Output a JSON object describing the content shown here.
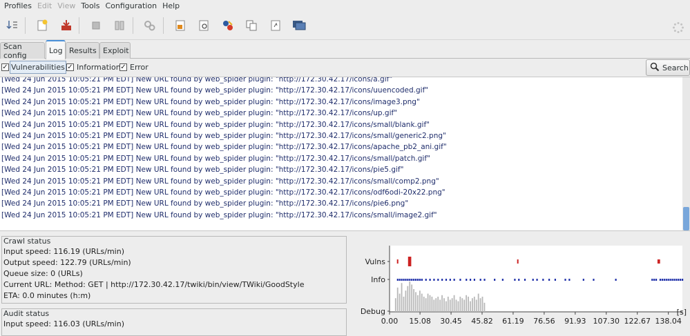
{
  "menu": {
    "items": [
      {
        "label": "Profiles",
        "enabled": true
      },
      {
        "label": "Edit",
        "enabled": false
      },
      {
        "label": "View",
        "enabled": false
      },
      {
        "label": "Tools",
        "enabled": true
      },
      {
        "label": "Configuration",
        "enabled": true
      },
      {
        "label": "Help",
        "enabled": true
      }
    ]
  },
  "toolbar": {
    "buttons": [
      "import-down-icon",
      "new-profile-icon",
      "save-profile-icon",
      "stop-icon",
      "pause-icon",
      "settings-gears-icon",
      "proxy-icon",
      "manual-request-icon",
      "fuzzy-request-icon",
      "compare-icon",
      "encode-decode-icon",
      "cluster-icon"
    ],
    "spinner_icon": "throbber-icon"
  },
  "tabs": [
    {
      "label": "Scan config",
      "active": false
    },
    {
      "label": "Log",
      "active": true
    },
    {
      "label": "Results",
      "active": false
    },
    {
      "label": "Exploit",
      "active": false
    }
  ],
  "filters": {
    "vulnerabilities": {
      "label": "Vulnerabilities",
      "checked": true
    },
    "information": {
      "label": "Information",
      "checked": true
    },
    "error": {
      "label": "Error",
      "checked": true
    },
    "search_label": "Search",
    "search_icon": "magnifier-icon"
  },
  "log": {
    "lines": [
      "[Wed 24 Jun 2015 10:05:21 PM EDT] New URL found by web_spider plugin: \"http://172.30.42.17/icons/a.gif\"",
      "[Wed 24 Jun 2015 10:05:21 PM EDT] New URL found by web_spider plugin: \"http://172.30.42.17/icons/uuencoded.gif\"",
      "[Wed 24 Jun 2015 10:05:21 PM EDT] New URL found by web_spider plugin: \"http://172.30.42.17/icons/image3.png\"",
      "[Wed 24 Jun 2015 10:05:21 PM EDT] New URL found by web_spider plugin: \"http://172.30.42.17/icons/up.gif\"",
      "[Wed 24 Jun 2015 10:05:21 PM EDT] New URL found by web_spider plugin: \"http://172.30.42.17/icons/small/blank.gif\"",
      "[Wed 24 Jun 2015 10:05:21 PM EDT] New URL found by web_spider plugin: \"http://172.30.42.17/icons/small/generic2.png\"",
      "[Wed 24 Jun 2015 10:05:21 PM EDT] New URL found by web_spider plugin: \"http://172.30.42.17/icons/apache_pb2_ani.gif\"",
      "[Wed 24 Jun 2015 10:05:21 PM EDT] New URL found by web_spider plugin: \"http://172.30.42.17/icons/small/patch.gif\"",
      "[Wed 24 Jun 2015 10:05:21 PM EDT] New URL found by web_spider plugin: \"http://172.30.42.17/icons/pie5.gif\"",
      "[Wed 24 Jun 2015 10:05:21 PM EDT] New URL found by web_spider plugin: \"http://172.30.42.17/icons/small/comp2.png\"",
      "[Wed 24 Jun 2015 10:05:21 PM EDT] New URL found by web_spider plugin: \"http://172.30.42.17/icons/odf6odi-20x22.png\"",
      "[Wed 24 Jun 2015 10:05:21 PM EDT] New URL found by web_spider plugin: \"http://172.30.42.17/icons/pie6.png\"",
      "[Wed 24 Jun 2015 10:05:21 PM EDT] New URL found by web_spider plugin: \"http://172.30.42.17/icons/small/image2.gif\""
    ]
  },
  "crawl_status": {
    "title": "Crawl status",
    "lines": [
      "Input speed: 116.19 (URLs/min)",
      "Output speed: 122.79 (URLs/min)",
      "Queue size: 0 (URLs)",
      "Current URL: Method: GET | http://172.30.42.17/twiki/bin/view/TWiki/GoodStyle",
      "ETA: 0.0 minutes (h:m)"
    ]
  },
  "audit_status": {
    "title": "Audit status",
    "lines": [
      "Input speed: 116.03 (URLs/min)"
    ]
  },
  "chart_data": {
    "type": "scatter",
    "title": "",
    "xlabel": "[s]",
    "ylabel": "",
    "x_ticks": [
      "0.00",
      "15.08",
      "30.45",
      "45.82",
      "61.19",
      "76.56",
      "91.93",
      "107.30",
      "122.67",
      "138.04"
    ],
    "xlim": [
      0,
      145
    ],
    "rows": [
      "Vulns",
      "Info",
      "Debug"
    ],
    "colors": {
      "vulns": "#cc2222",
      "info": "#2233aa",
      "debug": "#b8b8b8"
    },
    "series": [
      {
        "name": "Vulns",
        "x": [
          4.0,
          9.5,
          10.0,
          10.4,
          63.5,
          133.0,
          133.6
        ]
      },
      {
        "name": "Info",
        "x": [
          4,
          5,
          6,
          7,
          8,
          9,
          10,
          11,
          12,
          13,
          14,
          15,
          16,
          18,
          20,
          22,
          24,
          26,
          28,
          30,
          32,
          35,
          38,
          40,
          42,
          45,
          47,
          52,
          56,
          62,
          64,
          67,
          71,
          73,
          76,
          79,
          82,
          87,
          89,
          96,
          101,
          112,
          130,
          131,
          132,
          134,
          135,
          136,
          137,
          138,
          139,
          140,
          141,
          142,
          143,
          144,
          145
        ]
      },
      {
        "name": "Debug",
        "x": [
          3,
          4,
          5,
          6,
          7,
          8,
          9,
          10,
          11,
          12,
          13,
          14,
          15,
          16,
          17,
          18,
          19,
          20,
          21,
          22,
          23,
          24,
          25,
          26,
          27,
          28,
          29,
          30,
          31,
          32,
          33,
          34,
          35,
          36,
          37,
          38,
          39,
          40,
          41,
          42,
          43,
          44,
          45,
          46,
          47
        ],
        "values": [
          0.45,
          0.8,
          0.6,
          0.95,
          0.5,
          0.7,
          0.85,
          1.0,
          0.9,
          0.75,
          0.65,
          0.55,
          0.7,
          0.6,
          0.5,
          0.45,
          0.6,
          0.55,
          0.5,
          0.4,
          0.45,
          0.5,
          0.4,
          0.55,
          0.45,
          0.35,
          0.5,
          0.4,
          0.45,
          0.55,
          0.4,
          0.35,
          0.5,
          0.45,
          0.4,
          0.55,
          0.5,
          0.35,
          0.45,
          0.5,
          0.4,
          0.6,
          0.45,
          0.5,
          0.3
        ]
      }
    ]
  }
}
